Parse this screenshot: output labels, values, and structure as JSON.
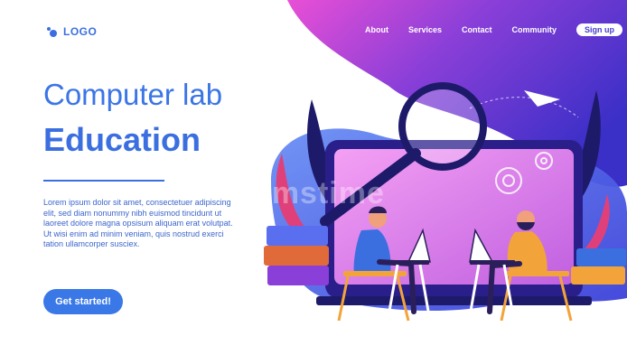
{
  "logo": {
    "text": "LOGO",
    "icon": "logo-dots-icon"
  },
  "nav": {
    "items": [
      {
        "label": "About"
      },
      {
        "label": "Services"
      },
      {
        "label": "Contact"
      },
      {
        "label": "Community"
      }
    ],
    "signup_label": "Sign up"
  },
  "hero": {
    "title_line1": "Computer lab",
    "title_line2": "Education",
    "body": "Lorem ipsum dolor sit amet, consectetuer adipiscing elit, sed diam nonummy nibh euismod tincidunt ut laoreet dolore magna opsisum aliquam erat volutpat. Ut wisi enim ad minim veniam, quis nostrud exerci tation ullamcorper susciex.",
    "cta_label": "Get started!"
  },
  "watermark": "dreamstime",
  "colors": {
    "primary": "#3b6fe0",
    "blob_start": "#e84dd8",
    "blob_end": "#3a2fc7",
    "accent_pink": "#e0407a",
    "accent_purple": "#c85adf"
  }
}
